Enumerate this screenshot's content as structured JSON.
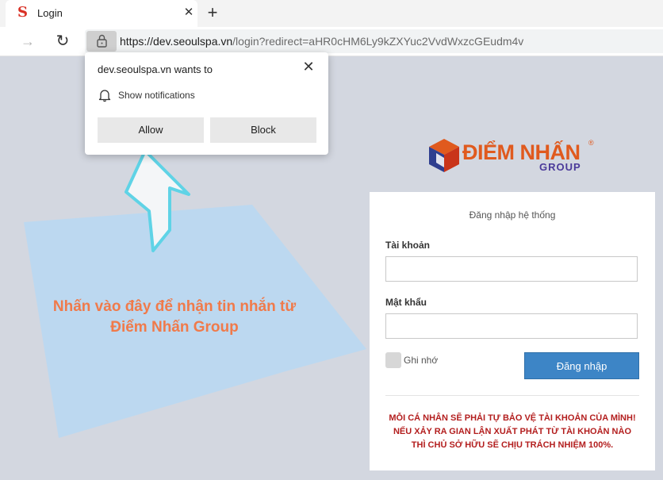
{
  "browser": {
    "tab": {
      "favicon": "S",
      "title": "Login",
      "close": "✕"
    },
    "new_tab": "+",
    "forward_icon": "→",
    "reload_icon": "↻",
    "url_host": "https://dev.seoulspa.vn",
    "url_path": "/login?redirect=aHR0cHM6Ly9kZXYuc2VvdWxzcGEudm4v"
  },
  "popup": {
    "title": "dev.seoulspa.vn wants to",
    "permission": "Show notifications",
    "allow": "Allow",
    "block": "Block",
    "close": "✕"
  },
  "annotation": {
    "line1": "Nhấn vào đây để nhận tin nhắn từ",
    "line2": "Điểm Nhấn Group"
  },
  "logo": {
    "main": "ĐIỂM NHẤN",
    "registered": "®",
    "sub": "GROUP"
  },
  "login": {
    "heading": "Đăng nhập hệ thống",
    "username_label": "Tài khoản",
    "username_value": "",
    "password_label": "Mật khẩu",
    "password_value": "",
    "remember_label": "Ghi nhớ",
    "submit": "Đăng nhập",
    "warning": [
      "MỖI CÁ NHÂN SẼ PHẢI TỰ BẢO VỆ TÀI KHOẢN CỦA MÌNH!",
      "NẾU XẢY RA GIAN LẬN XUẤT PHÁT TỪ TÀI KHOẢN NÀO",
      "THÌ CHỦ SỞ HỮU SẼ CHỊU TRÁCH NHIỆM 100%."
    ]
  },
  "colors": {
    "page_bg": "#d3d7e0",
    "blob": "#bcd8f0",
    "annotation_text": "#f07a4a",
    "brand_orange": "#e05a1e",
    "brand_purple": "#4b3a9a",
    "button_blue": "#3d85c6",
    "warning_red": "#b31e1e",
    "arrow_stroke": "#5fd3e6"
  }
}
